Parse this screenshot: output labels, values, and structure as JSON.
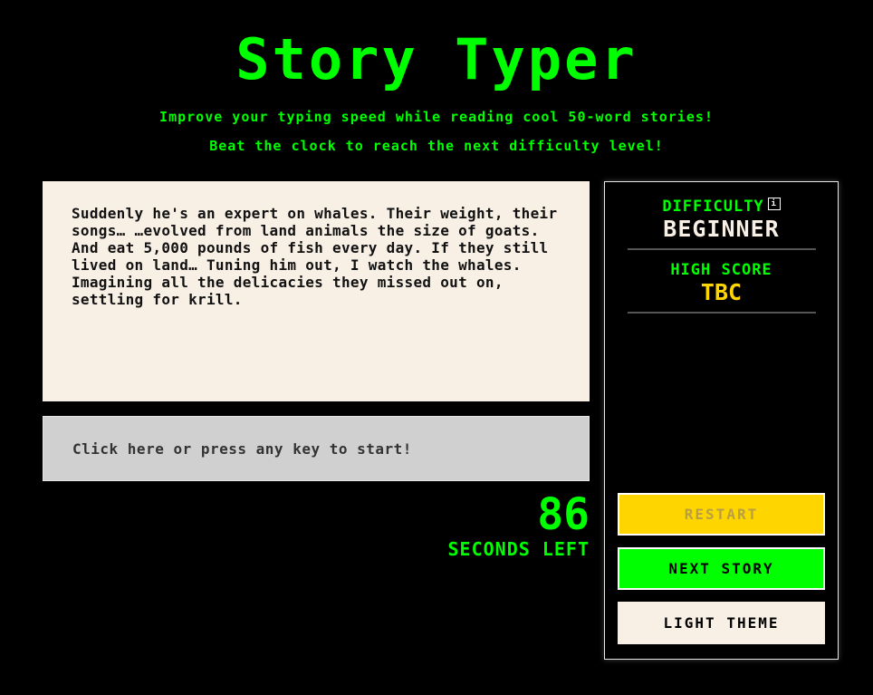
{
  "header": {
    "title": "Story Typer",
    "subtitle_line1": "Improve your typing speed while reading cool 50-word stories!",
    "subtitle_line2": "Beat the clock to reach the next difficulty level!"
  },
  "story": {
    "text": "Suddenly he's an expert on whales. Their weight, their songs… …evolved from land animals the size of goats. And eat 5,000 pounds of fish every day. If they still lived on land… Tuning him out, I watch the whales. Imagining all the delicacies they missed out on, settling for krill."
  },
  "input": {
    "prompt": "Click here or press any key to start!"
  },
  "timer": {
    "value": "86",
    "label": "SECONDS LEFT"
  },
  "sidebar": {
    "difficulty_label": "DIFFICULTY",
    "info_icon": "i",
    "difficulty_value": "BEGINNER",
    "high_score_label": "HIGH SCORE",
    "high_score_value": "TBC",
    "restart_label": "RESTART",
    "next_story_label": "NEXT STORY",
    "theme_label": "LIGHT THEME"
  },
  "colors": {
    "accent_green": "#00ff00",
    "accent_yellow": "#ffd500",
    "cream": "#f8efe5",
    "input_gray": "#d0d0d0",
    "background": "#000000"
  }
}
